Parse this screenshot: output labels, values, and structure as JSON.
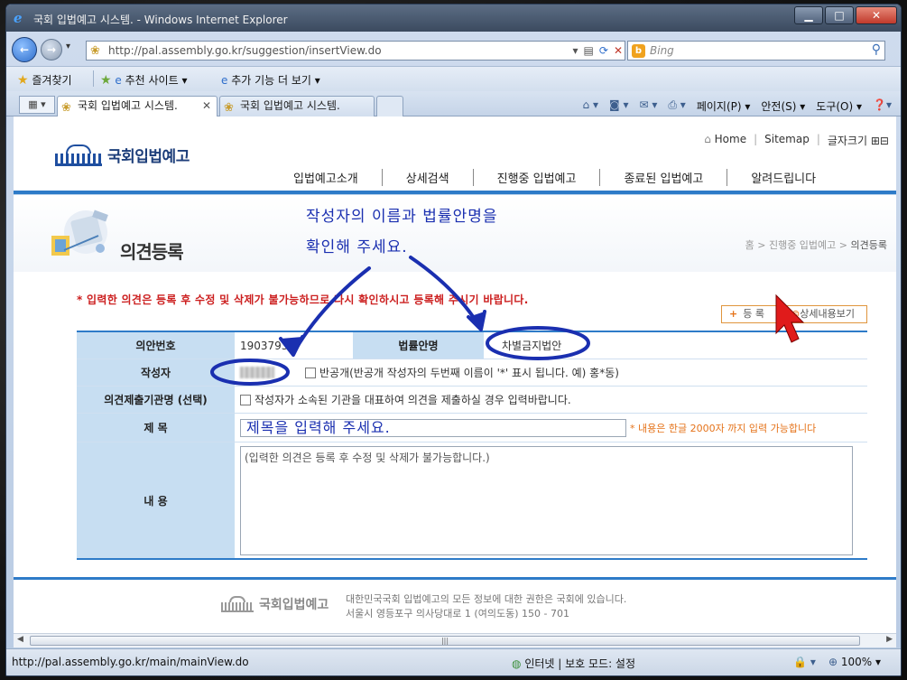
{
  "browser": {
    "window_title": "국회 입법예고 시스템. - Windows Internet Explorer",
    "address_url": "http://pal.assembly.go.kr/suggestion/insertView.do",
    "address_host": "assembly.go.kr",
    "search_placeholder": "Bing",
    "favorites_label": "즐겨찾기",
    "suggested_sites_label": "추천 사이트 ▾",
    "addons_label": "추가 기능 더 보기 ▾",
    "tabs": [
      {
        "label": "국회 입법예고 시스템.",
        "active": true
      },
      {
        "label": "국회 입법예고 시스템.",
        "active": false
      }
    ],
    "command_bar": {
      "page": "페이지(P) ▾",
      "safety": "안전(S) ▾",
      "tools": "도구(O) ▾"
    },
    "status_url": "http://pal.assembly.go.kr/main/mainView.do",
    "status_zone": "인터넷 | 보호 모드: 설정",
    "zoom": "100%"
  },
  "site": {
    "logo_text": "국회입법예고",
    "util": {
      "home": "Home",
      "sitemap": "Sitemap",
      "font_size": "글자크기"
    },
    "gnb": [
      "입법예고소개",
      "상세검색",
      "진행중 입법예고",
      "종료된 입법예고",
      "알려드립니다"
    ],
    "page_title": "의견등록",
    "breadcrumb": {
      "home": "홈",
      "mid": "진행중 입법예고",
      "current": "의견등록"
    },
    "notice": "* 입력한 의견은 등록 후 수정 및 삭제가 불가능하므로 다시 확인하시고 등록해 주시기 바랍니다.",
    "buttons": {
      "register": "등 록",
      "detail": "상세내용보기"
    },
    "form": {
      "bill_no_label": "의안번호",
      "bill_no_value": "1903793",
      "bill_name_label": "법률안명",
      "bill_name_value": "차별금지법안",
      "author_label": "작성자",
      "private_option": "반공개(반공개 작성자의 두번째 이름이 '*' 표시 됩니다. 예) 홍*동)",
      "org_label": "의견제출기관명 (선택)",
      "org_option": "작성자가 소속된 기관을 대표하여 의견을 제출하실 경우 입력바랍니다.",
      "title_label": "제 목",
      "title_value": "제목을 입력해 주세요.",
      "title_limit": "* 내용은 한글 2000자 까지 입력 가능합니다",
      "content_label": "내 용",
      "content_placeholder": "(입력한 의견은 등록 후 수정 및 삭제가 불가능합니다.)"
    },
    "footer": {
      "logo_text": "국회입법예고",
      "line1": "대한민국국회 입법예고의 모든 정보에 대한 권한은 국회에 있습니다.",
      "line2": "서울시 영등포구 의사당대로 1 (여의도동) 150 - 701"
    }
  },
  "annotation": {
    "line1": "작성자의 이름과 법률안명을",
    "line2": "확인해 주세요.",
    "color": "#1a2fb0"
  }
}
